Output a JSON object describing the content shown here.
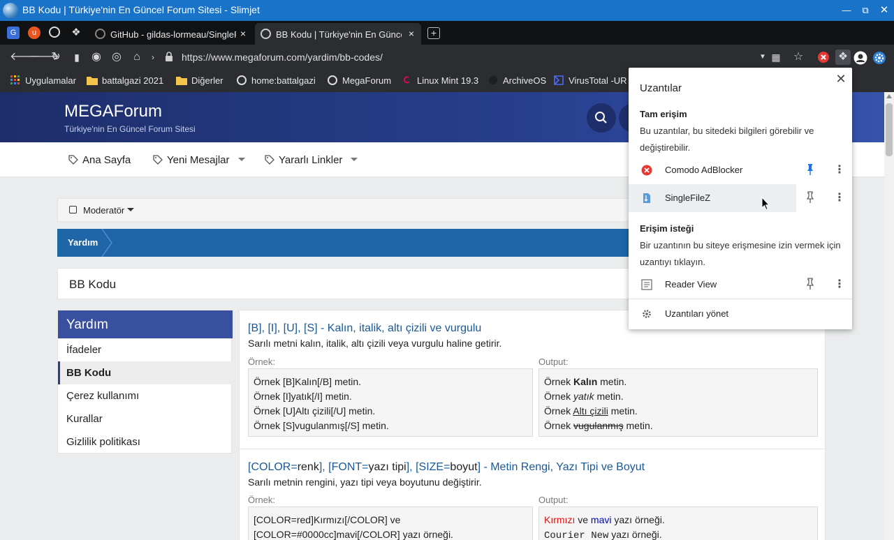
{
  "window": {
    "title": "BB Kodu | Türkiye'nin En Güncel Forum Sitesi - Slimjet"
  },
  "tabs": [
    {
      "label": "GitHub - gildas-lormeau/SingleFile"
    },
    {
      "label": "BB Kodu | Türkiye'nin En Güncel"
    }
  ],
  "toolbar": {
    "url": "https://www.megaforum.com/yardim/bb-codes/"
  },
  "bookmarks": [
    {
      "label": "Uygulamalar"
    },
    {
      "label": "battalgazi 2021"
    },
    {
      "label": "Diğerler"
    },
    {
      "label": "home:battalgazi"
    },
    {
      "label": "MegaForum"
    },
    {
      "label": "Linux Mint 19.3"
    },
    {
      "label": "ArchiveOS"
    },
    {
      "label": "VirusTotal -UR"
    }
  ],
  "site": {
    "name": "MEGAForum",
    "tagline": "Türkiye'nin En Güncel Forum Sitesi",
    "nav": [
      {
        "label": "Ana Sayfa"
      },
      {
        "label": "Yeni Mesajlar"
      },
      {
        "label": "Yararlı Linkler"
      }
    ],
    "moderator_label": "Moderatör",
    "breadcrumb": "Yardım",
    "page_title": "BB Kodu",
    "sidebar": {
      "title": "Yardım",
      "items": [
        {
          "label": "İfadeler"
        },
        {
          "label": "BB Kodu"
        },
        {
          "label": "Çerez kullanımı"
        },
        {
          "label": "Kurallar"
        },
        {
          "label": "Gizlilik politikası"
        }
      ]
    },
    "sections": [
      {
        "title": "[B], [I], [U], [S] - Kalın, italik, altı çizili ve vurgulu",
        "desc": "Sarılı metni kalın, italik, altı çizili veya vurgulu haline getirir.",
        "example_label": "Örnek:",
        "output_label": "Output:",
        "examples": [
          "Örnek [B]Kalın[/B] metin.",
          "Örnek [I]yatık[/I] metin.",
          "Örnek [U]Altı çizili[/U] metin.",
          "Örnek [S]vugulanmış[/S] metin."
        ],
        "outputs": {
          "prefix": "Örnek ",
          "suffix": " metin.",
          "bold": "Kalın",
          "italic": "yatık",
          "underline": "Altı çizili",
          "strike": "vugulanmış"
        }
      },
      {
        "title_parts": {
          "p1": "[COLOR=",
          "p2": "renk",
          "p3": "], [FONT=",
          "p4": "yazı tipi",
          "p5": "], [SIZE=",
          "p6": "boyut",
          "p7": "] - Metin Rengi, Yazı Tipi ve Boyut"
        },
        "desc": "Sarılı metnin rengini, yazı tipi veya boyutunu değiştirir.",
        "example_label": "Örnek:",
        "output_label": "Output:",
        "examples": [
          "[COLOR=red]Kırmızı[/COLOR] ve",
          "[COLOR=#0000cc]mavi[/COLOR] yazı örneği."
        ],
        "outputs": {
          "red": "Kırmızı",
          "and": " ve ",
          "blue": "mavi",
          "tail": " yazı örneği.",
          "courier": "Courier New",
          "tail2": " yazı örneği."
        }
      }
    ]
  },
  "extensions_popup": {
    "title": "Uzantılar",
    "full_access_heading": "Tam erişim",
    "full_access_desc": "Bu uzantılar, bu sitedeki bilgileri görebilir ve değiştirebilir.",
    "full_access_items": [
      {
        "name": "Comodo AdBlocker"
      },
      {
        "name": "SingleFileZ"
      }
    ],
    "request_heading": "Erişim isteği",
    "request_desc": "Bir uzantının bu siteye erişmesine izin vermek için uzantıyı tıklayın.",
    "request_items": [
      {
        "name": "Reader View"
      }
    ],
    "manage_label": "Uzantıları yönet"
  },
  "colors": {
    "title_bar": "#1873c9",
    "site_header": "#283f8e",
    "breadcrumb": "#1e66a8",
    "link": "#1a5898",
    "pin_active": "#1a73e8"
  }
}
